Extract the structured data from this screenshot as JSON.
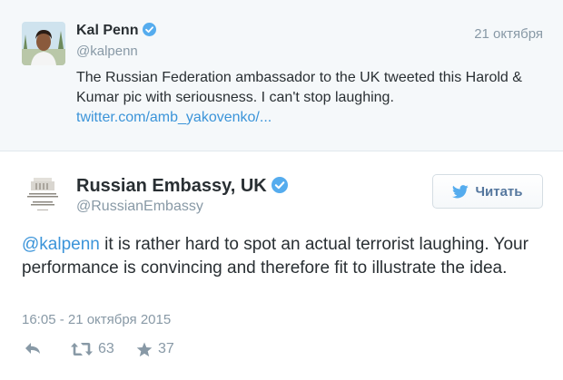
{
  "quoted_tweet": {
    "author_name": "Kal Penn",
    "handle": "@kalpenn",
    "date": "21 октября",
    "text": "The Russian Federation ambassador to the UK tweeted this Harold & Kumar pic with seriousness. I can't stop laughing.",
    "link": "twitter.com/amb_yakovenko/..."
  },
  "tweet": {
    "author_name": "Russian Embassy, UK",
    "handle": "@RussianEmbassy",
    "follow_label": "Читать",
    "mention": "@kalpenn",
    "text": " it is rather hard to spot an actual terrorist laughing. Your performance is convincing and therefore fit to illustrate the idea.",
    "timestamp": "16:05 - 21 октября 2015",
    "retweet_count": "63",
    "favorite_count": "37"
  },
  "icons": {
    "verified": "verified-badge-icon",
    "bird": "twitter-bird-icon",
    "reply": "reply-icon",
    "retweet": "retweet-icon",
    "favorite": "star-icon"
  },
  "colors": {
    "link": "#3b94d9",
    "muted": "#8899a6",
    "verified": "#55acee",
    "quoted_background": "#f5f8fa"
  }
}
